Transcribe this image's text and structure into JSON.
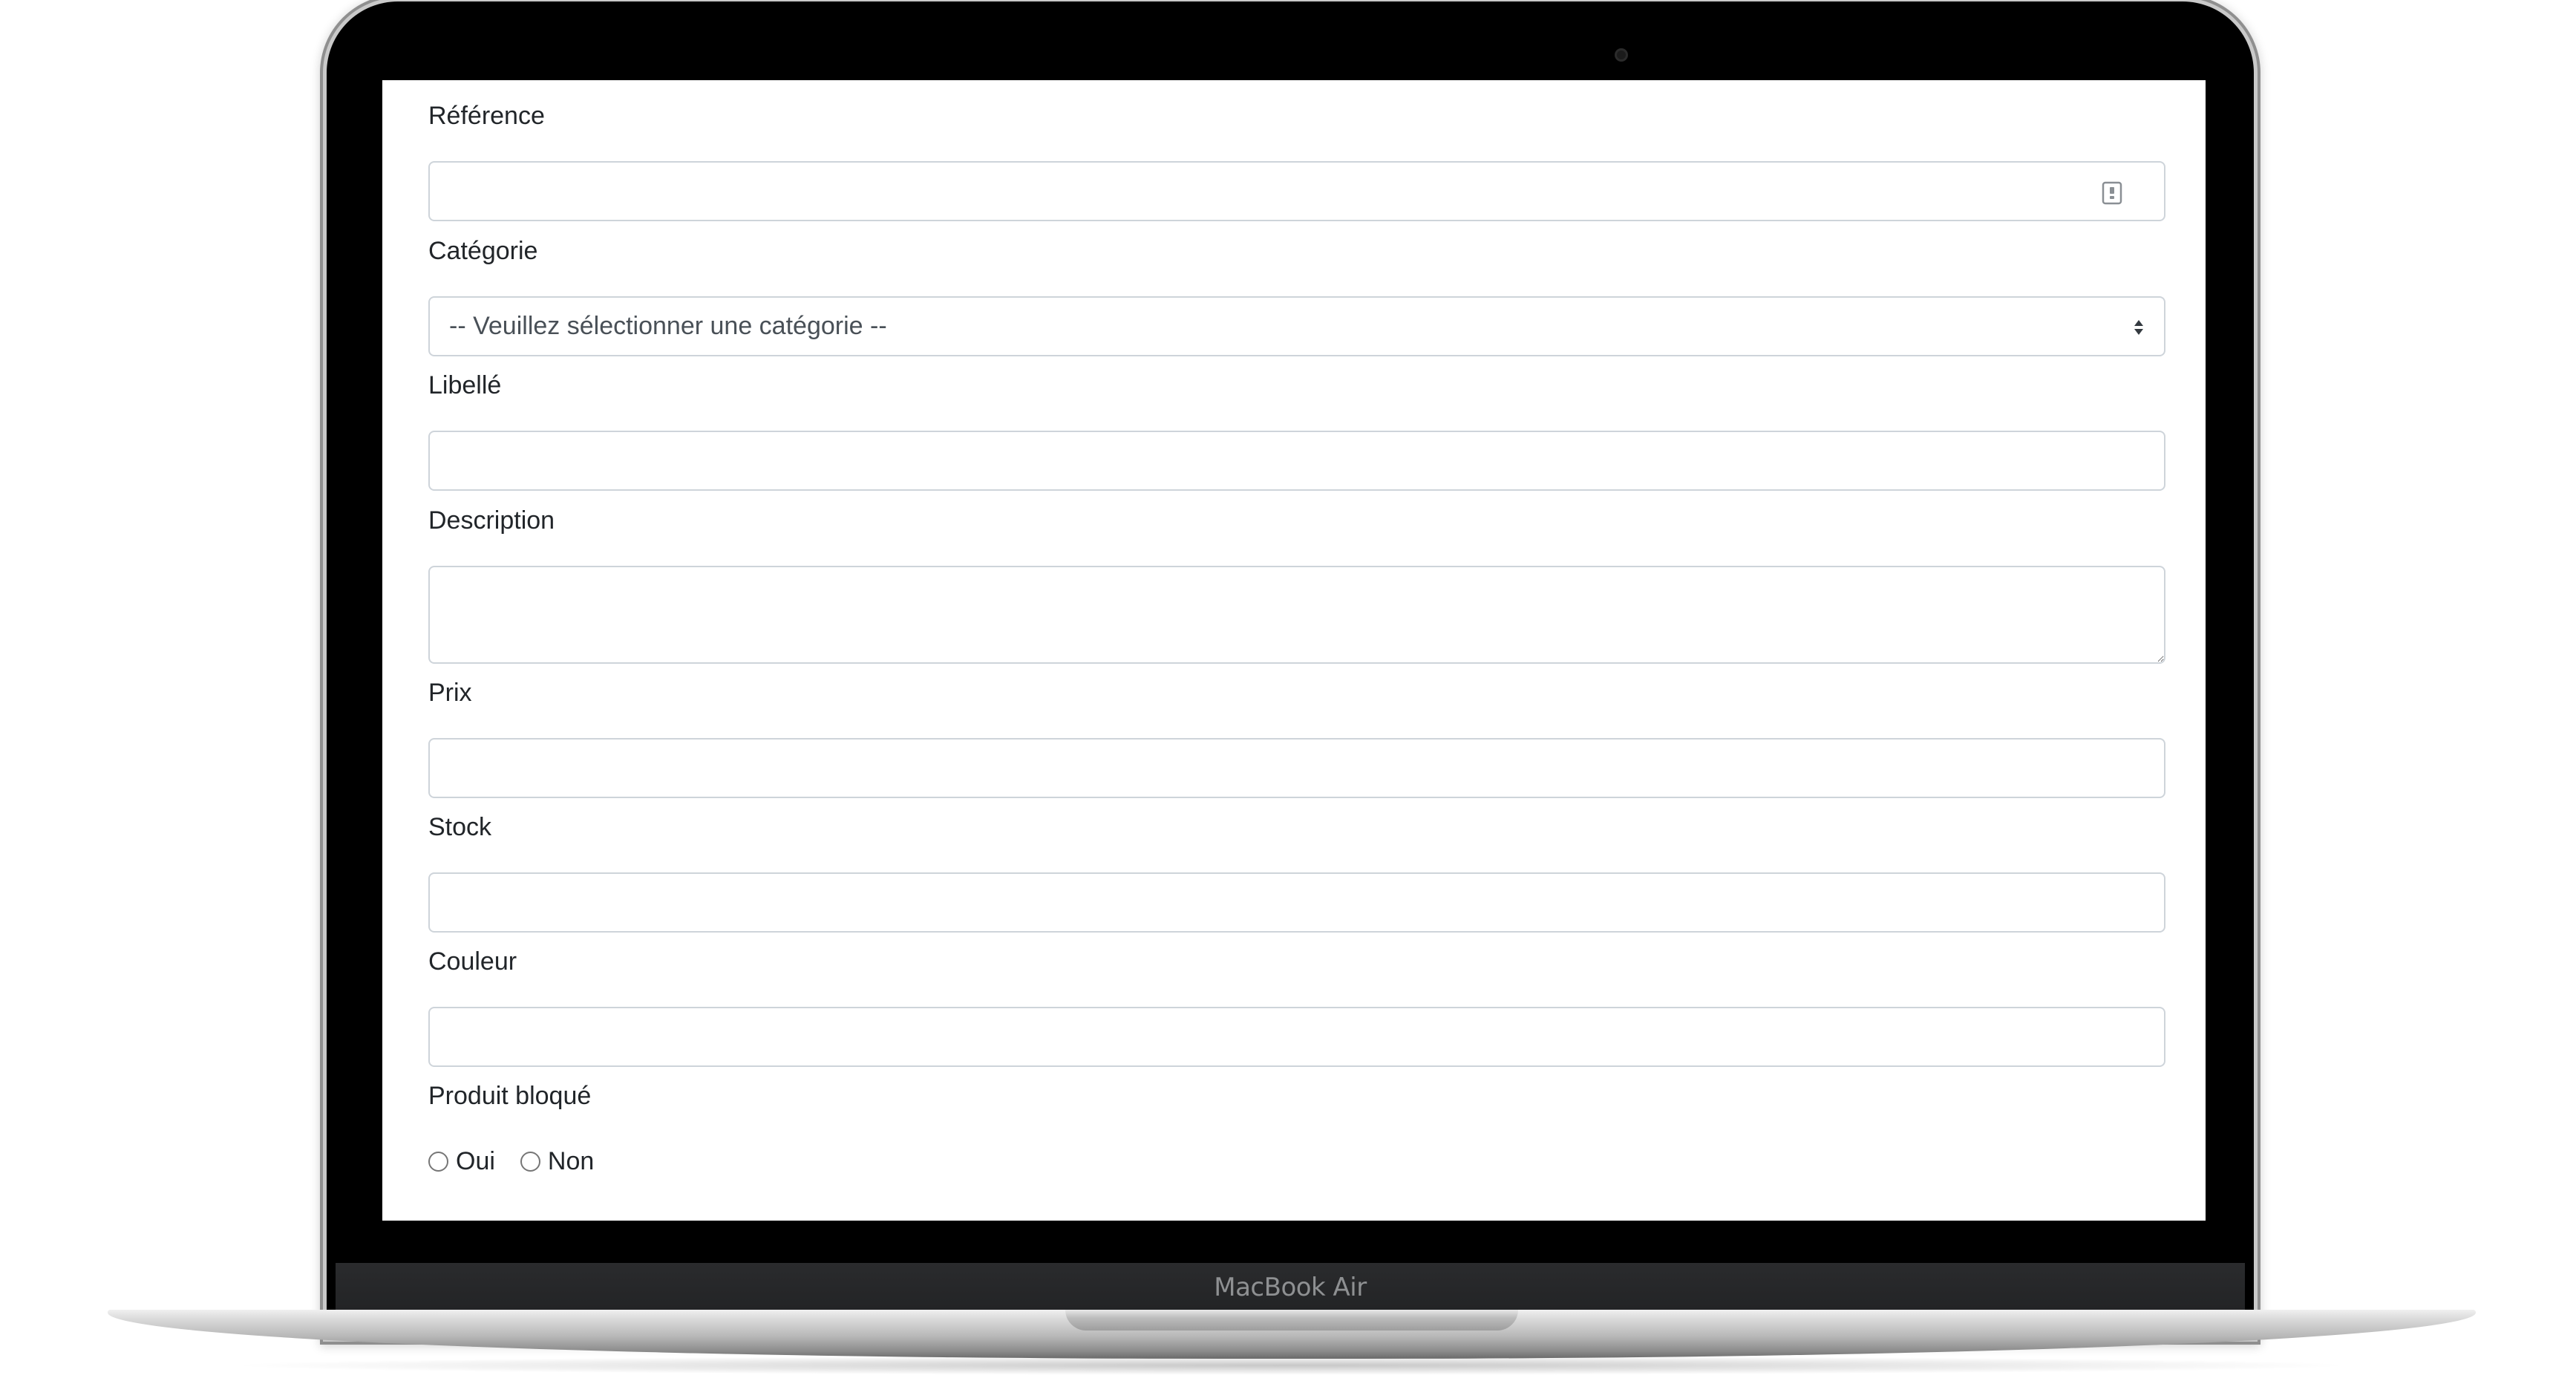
{
  "device": {
    "brand_label": "MacBook Air"
  },
  "form": {
    "reference": {
      "label": "Référence",
      "value": "",
      "icon": "id-card-icon"
    },
    "categorie": {
      "label": "Catégorie",
      "selected": "-- Veuillez sélectionner une catégorie --"
    },
    "libelle": {
      "label": "Libellé",
      "value": ""
    },
    "description": {
      "label": "Description",
      "value": ""
    },
    "prix": {
      "label": "Prix",
      "value": ""
    },
    "stock": {
      "label": "Stock",
      "value": ""
    },
    "couleur": {
      "label": "Couleur",
      "value": ""
    },
    "produit_bloque": {
      "label": "Produit bloqué",
      "options": [
        "Oui",
        "Non"
      ]
    }
  },
  "colors": {
    "input_border": "#ced4da",
    "label_text": "#212529",
    "input_text": "#495057",
    "screen_bezel": "#000000"
  }
}
